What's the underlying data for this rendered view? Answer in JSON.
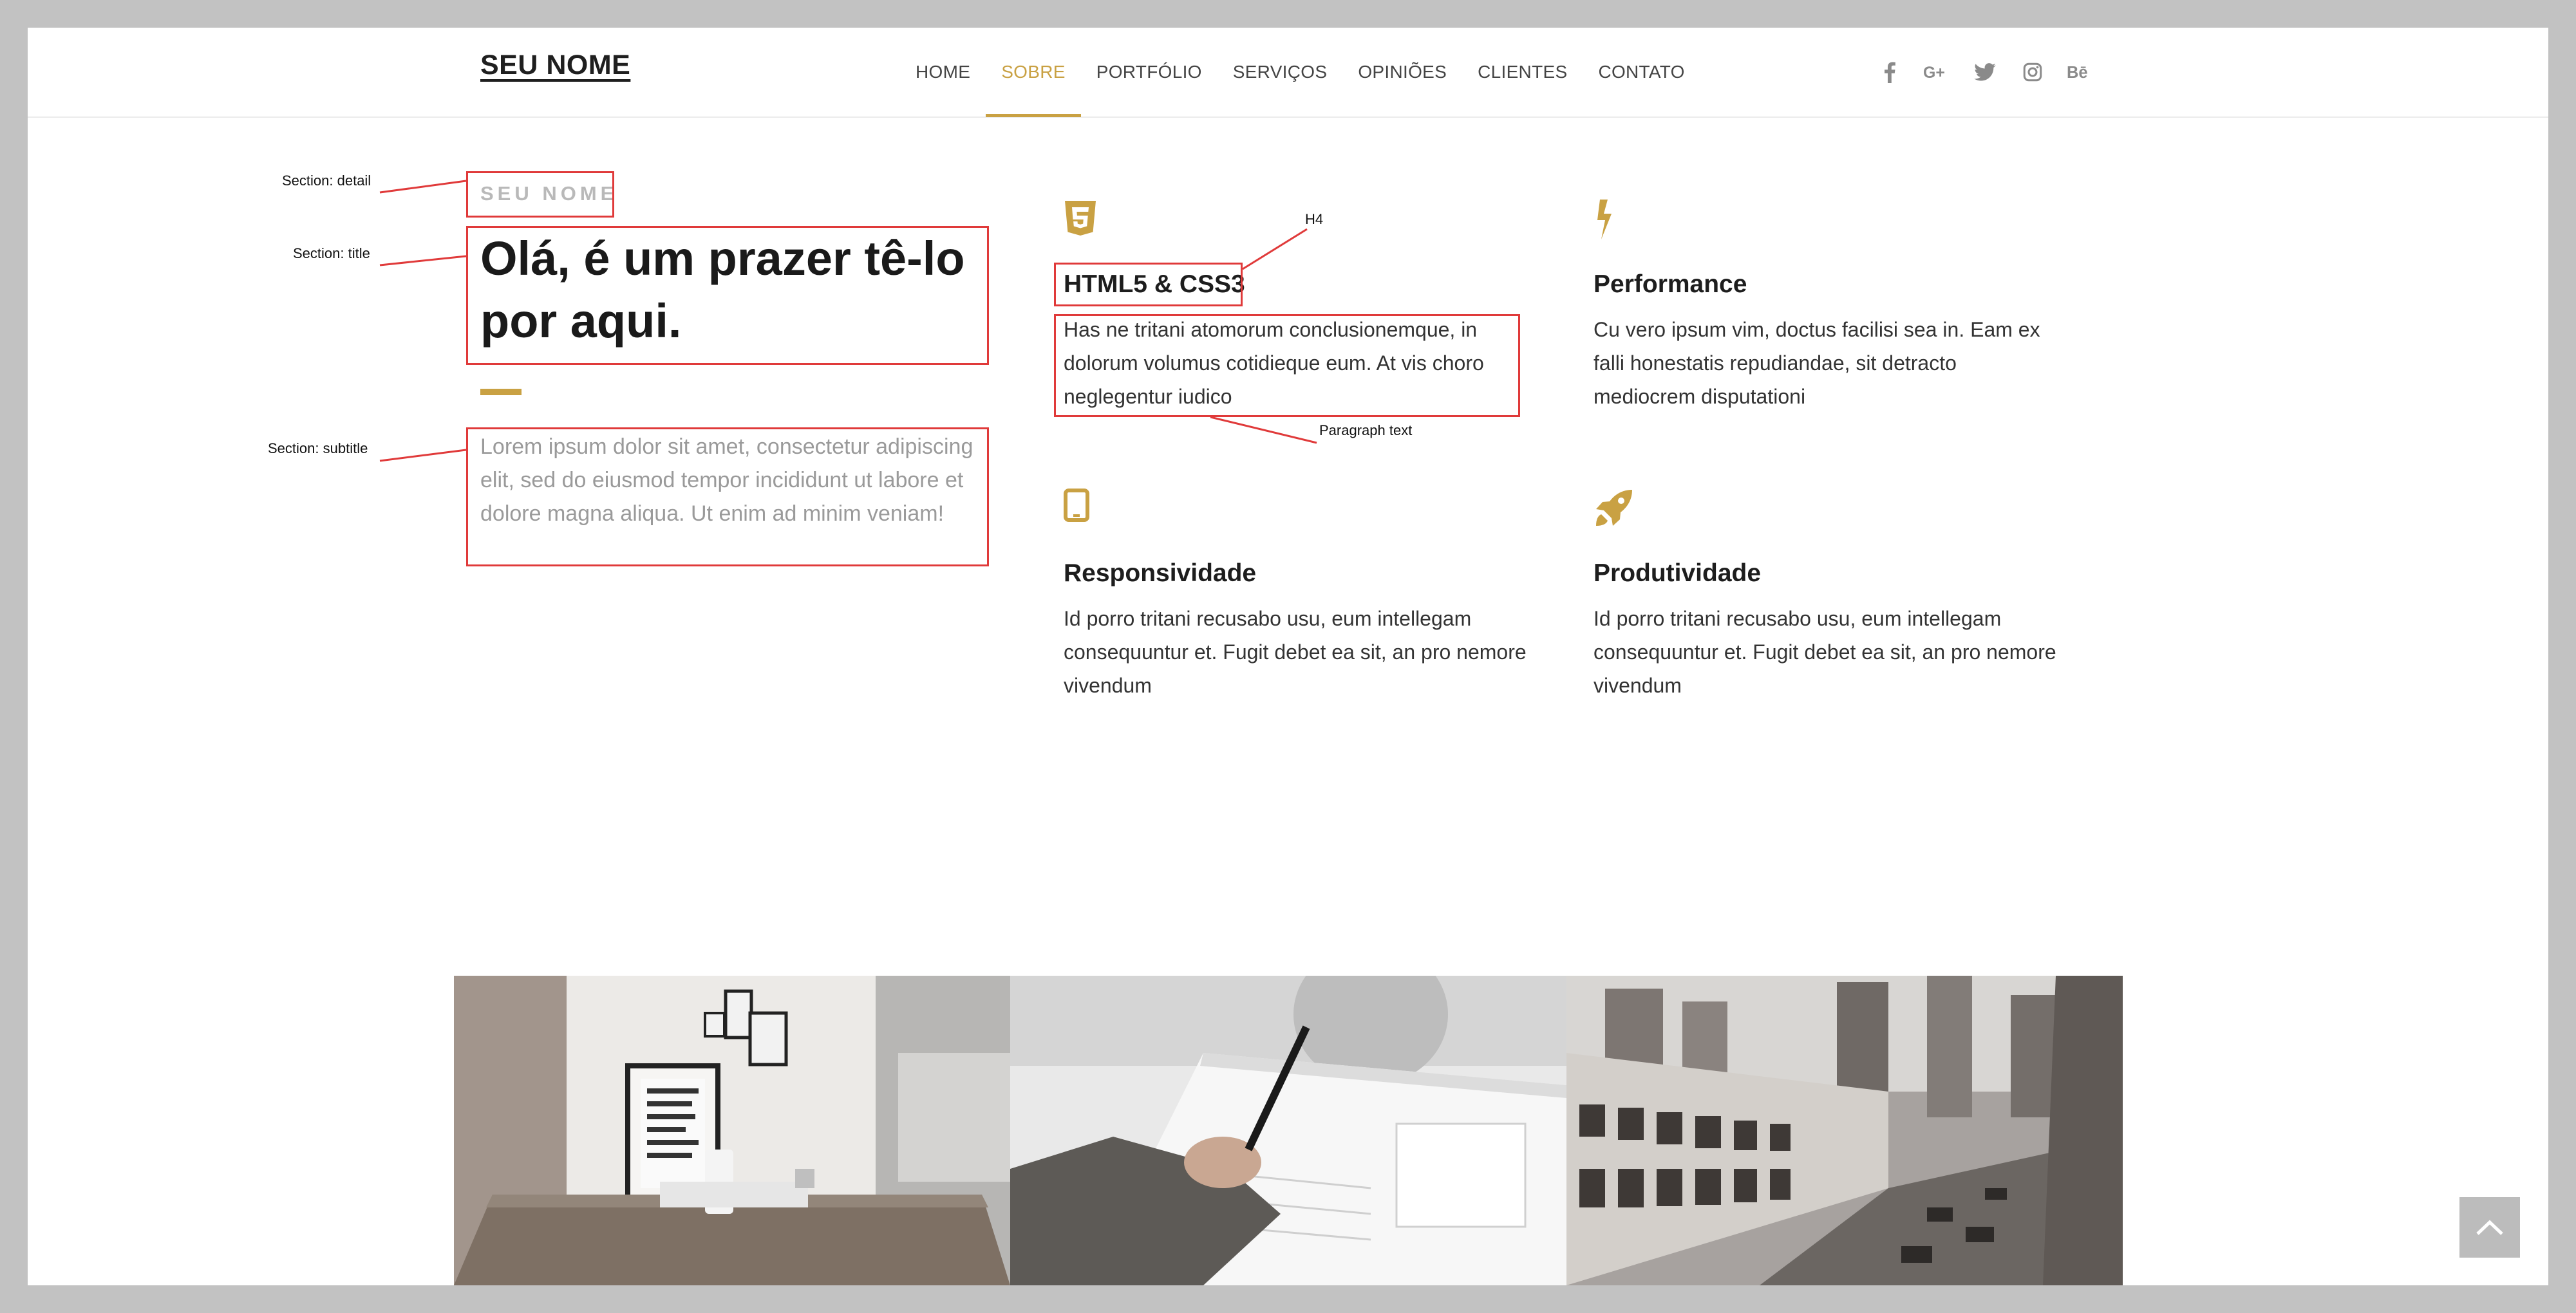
{
  "brand": "SEU NOME",
  "nav": {
    "items": [
      "HOME",
      "SOBRE",
      "PORTFÓLIO",
      "SERVIÇOS",
      "OPINIÕES",
      "CLIENTES",
      "CONTATO"
    ],
    "active": "SOBRE"
  },
  "social": [
    "f",
    "G+",
    "twitter",
    "instagram",
    "Bē"
  ],
  "about": {
    "detail": "SEU NOME",
    "title": "Olá, é um prazer tê-lo por aqui.",
    "subtitle": "Lorem ipsum dolor sit amet, consectetur adipiscing elit, sed do eiusmod tempor incididunt ut labore et dolore magna aliqua. Ut enim ad minim veniam!"
  },
  "features": [
    {
      "icon": "html5-icon",
      "title": "HTML5 & CSS3",
      "text": "Has ne tritani atomorum conclusionemque, in dolorum volumus cotidieque eum. At vis choro neglegentur iudico"
    },
    {
      "icon": "lightning-icon",
      "title": "Performance",
      "text": "Cu vero ipsum vim, doctus facilisi sea in. Eam ex falli honestatis repudiandae, sit detracto mediocrem disputationi"
    },
    {
      "icon": "tablet-icon",
      "title": "Responsividade",
      "text": "Id porro tritani recusabo usu, eum intellegam consequuntur et. Fugit debet ea sit, an pro nemore vivendum"
    },
    {
      "icon": "rocket-icon",
      "title": "Produtividade",
      "text": "Id porro tritani recusabo usu, eum intellegam consequuntur et. Fugit debet ea sit, an pro nemore vivendum"
    }
  ],
  "annotations": {
    "detail": "Section: detail",
    "title": "Section: title",
    "subtitle": "Section: subtitle",
    "h4": "H4",
    "paragraph": "Paragraph text"
  },
  "colors": {
    "accent": "#c9a143",
    "annotation": "#e03a3a",
    "frame": "#c2c2c2"
  }
}
